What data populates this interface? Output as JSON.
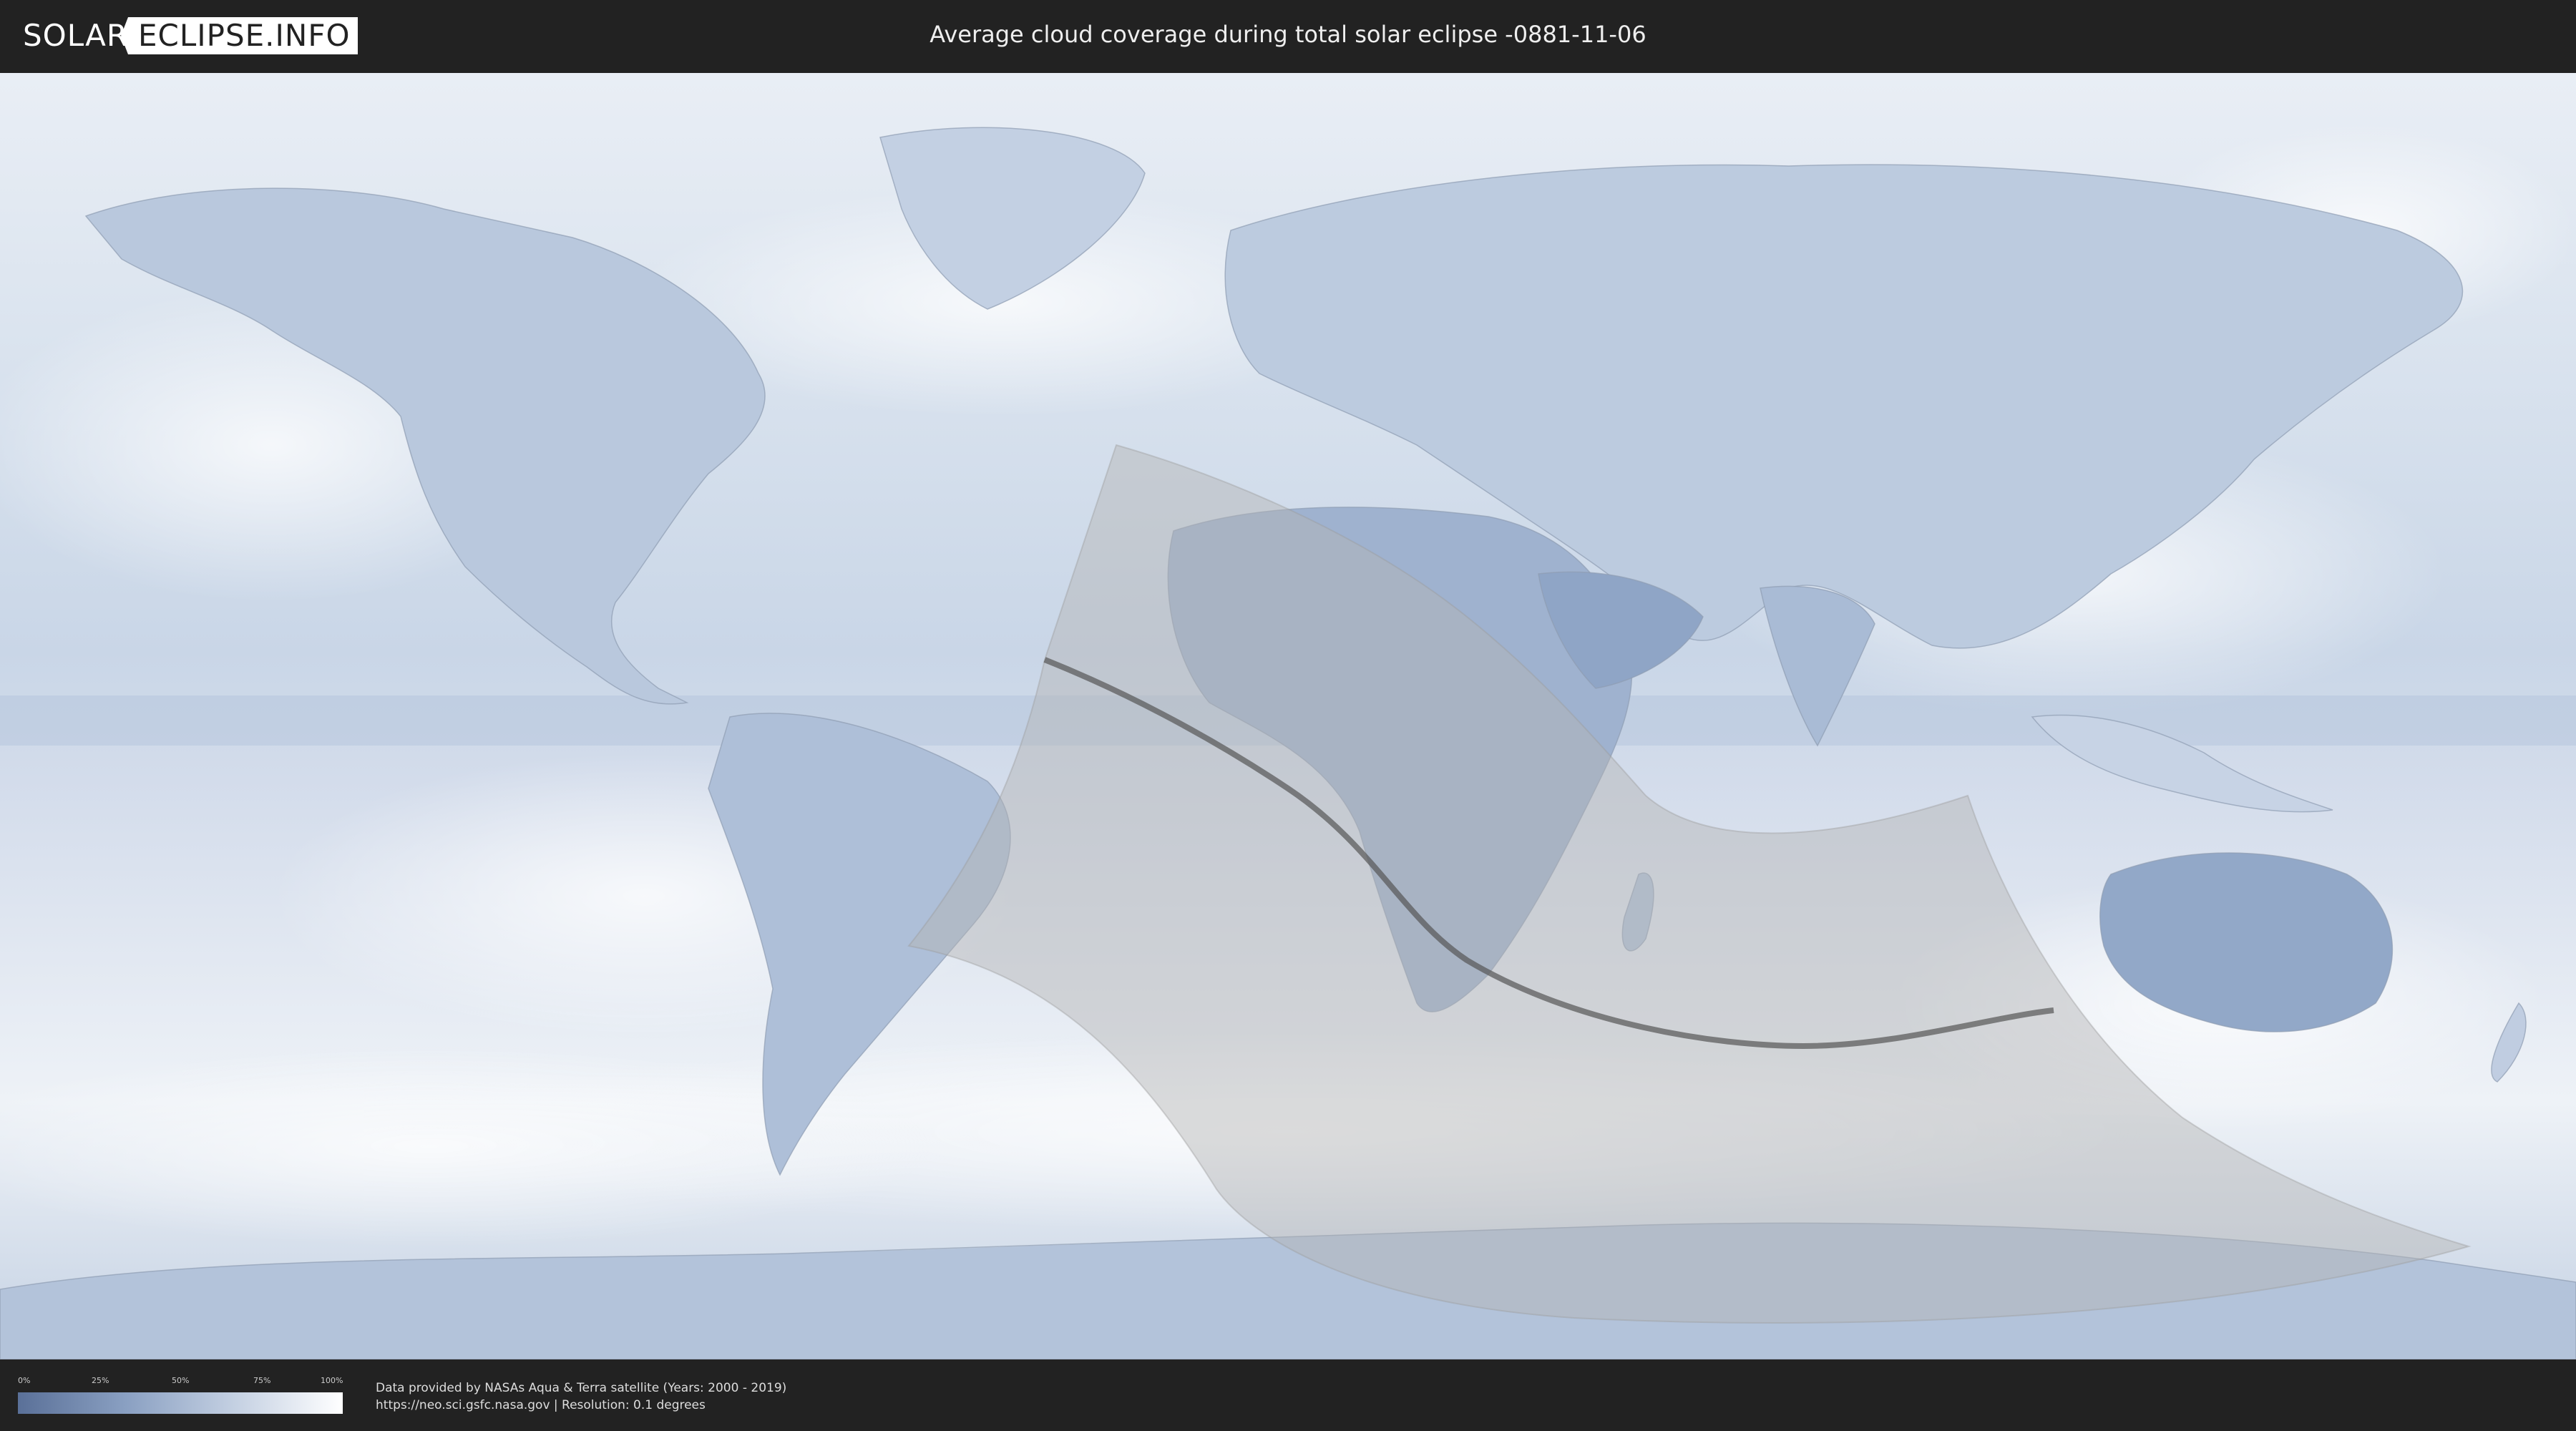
{
  "header": {
    "logo_left": "SOLAR",
    "logo_right": "ECLIPSE.INFO",
    "title": "Average cloud coverage during total solar eclipse -0881-11-06"
  },
  "legend": {
    "ticks": [
      "0%",
      "25%",
      "50%",
      "75%",
      "100%"
    ],
    "colors": {
      "low": "#5a7098",
      "high": "#ffffff"
    }
  },
  "footer": {
    "credit_line1": "Data provided by NASAs Aqua & Terra satellite (Years: 2000 - 2019)",
    "credit_line2": "https://neo.sci.gsfc.nasa.gov | Resolution: 0.1 degrees"
  },
  "colors": {
    "background": "#222222",
    "ocean_cloud": "#dfe7f1",
    "land_clear": "#6f87ad",
    "eclipse_zone": "#b4b4b4",
    "central_line": "#555555"
  }
}
